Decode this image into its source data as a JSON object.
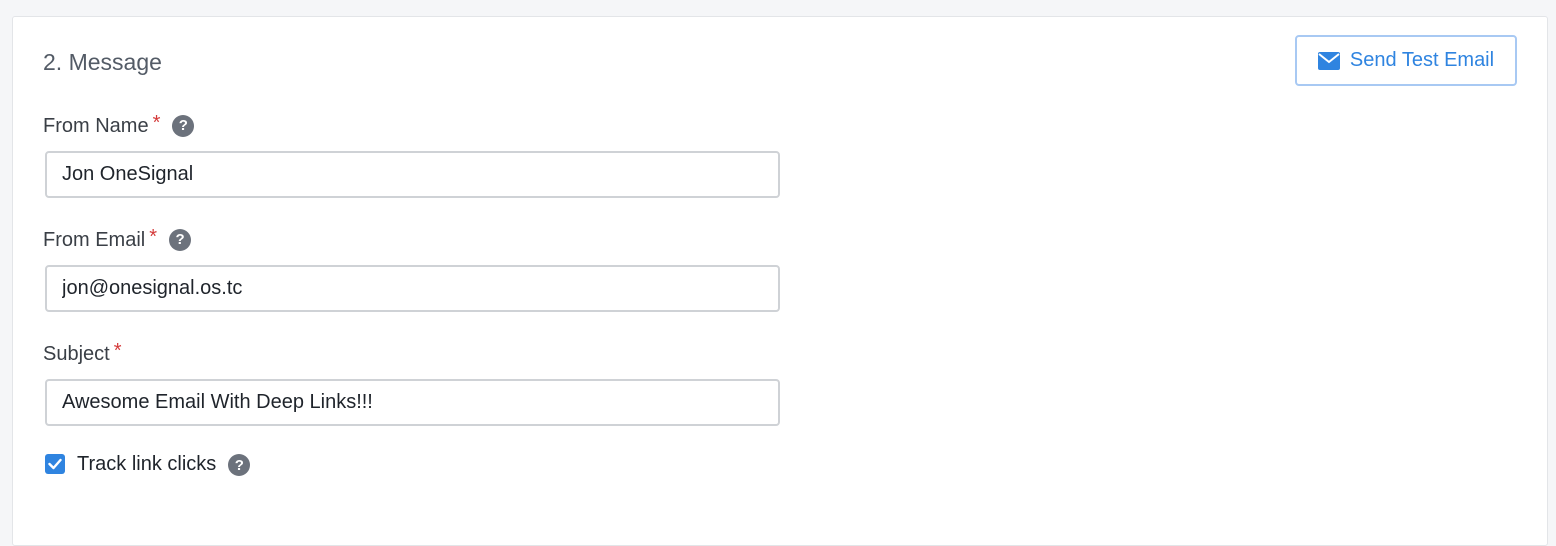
{
  "section": {
    "title": "2. Message"
  },
  "send_test_button": {
    "label": "Send Test Email",
    "icon": "mail-icon",
    "color": "#2f84e0"
  },
  "fields": {
    "from_name": {
      "label": "From Name",
      "required_mark": "*",
      "value": "Jon OneSignal",
      "help_icon": "?"
    },
    "from_email": {
      "label": "From Email",
      "required_mark": "*",
      "value": "jon@onesignal.os.tc",
      "help_icon": "?"
    },
    "subject": {
      "label": "Subject",
      "required_mark": "*",
      "value": "Awesome Email With Deep Links!!!"
    }
  },
  "track_clicks": {
    "label": "Track link clicks",
    "checked": true,
    "help_icon": "?"
  },
  "colors": {
    "accent": "#2f84e0",
    "required": "#d43a3a",
    "help_icon_bg": "#6c727c"
  }
}
